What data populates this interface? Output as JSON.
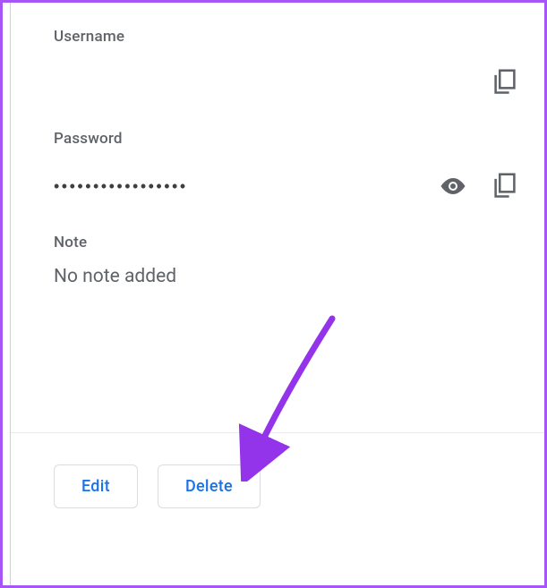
{
  "fields": {
    "username": {
      "label": "Username",
      "value": ""
    },
    "password": {
      "label": "Password",
      "masked": "•••••••••••••••••"
    },
    "note": {
      "label": "Note",
      "value": "No note added"
    }
  },
  "buttons": {
    "edit": "Edit",
    "delete": "Delete"
  },
  "colors": {
    "accent": "#1a73e8",
    "frame": "#a855f7",
    "arrow": "#9333ea",
    "muted": "#5f6368"
  }
}
